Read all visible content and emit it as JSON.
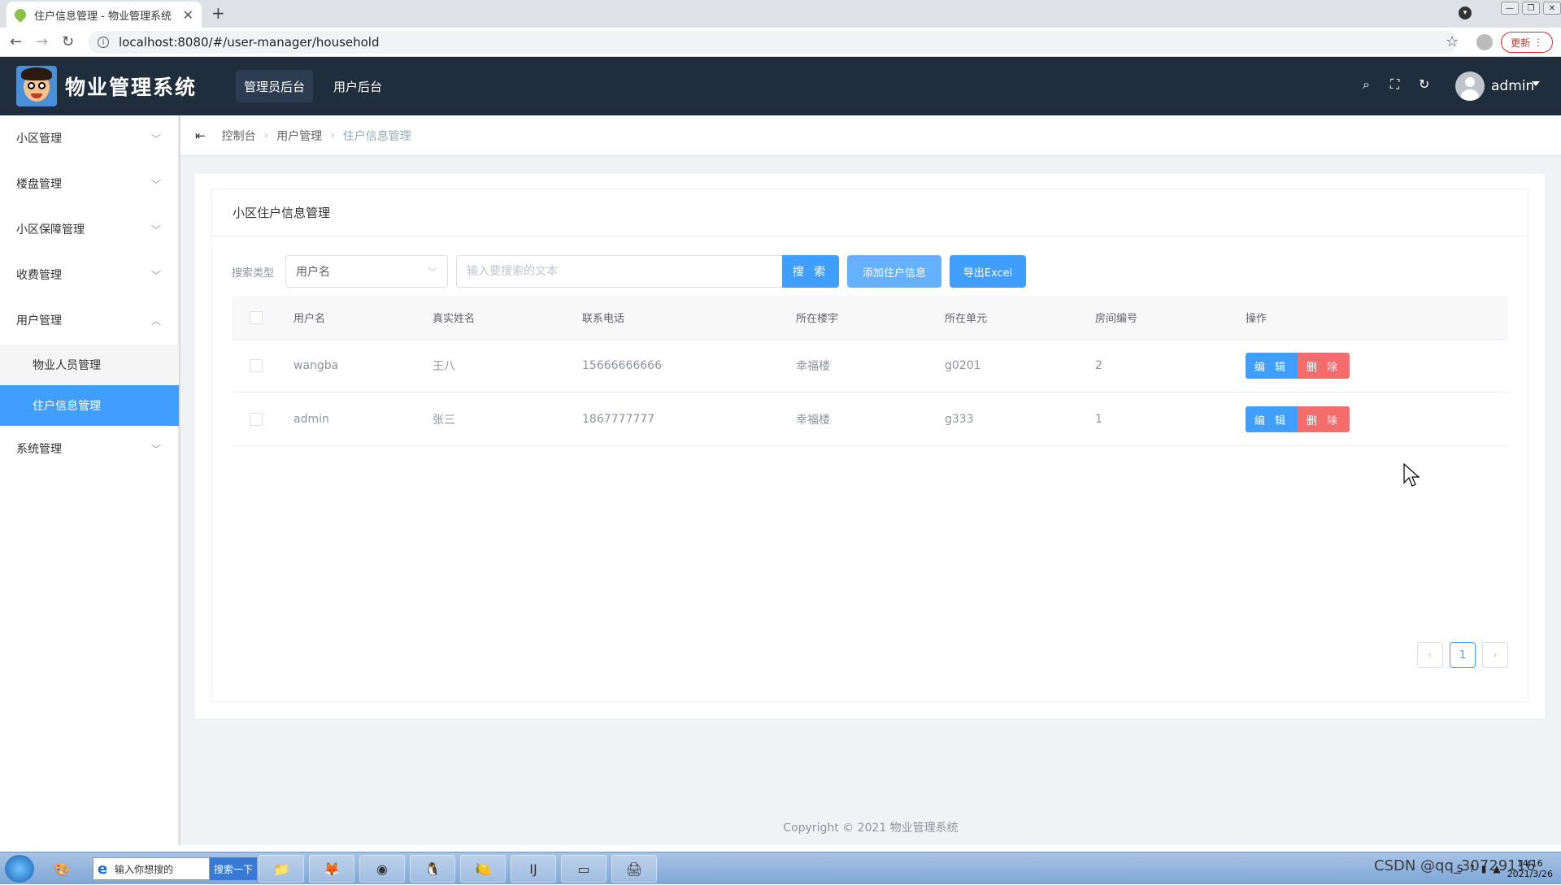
{
  "browser": {
    "tab_title": "住户信息管理 - 物业管理系统",
    "url": "localhost:8080/#/user-manager/household",
    "update_label": "更新"
  },
  "app": {
    "title": "物业管理系统",
    "nav": [
      "管理员后台",
      "用户后台"
    ],
    "user": "admin"
  },
  "sidebar": {
    "items": [
      {
        "label": "小区管理"
      },
      {
        "label": "楼盘管理"
      },
      {
        "label": "小区保障管理"
      },
      {
        "label": "收费管理"
      },
      {
        "label": "用户管理"
      },
      {
        "label": "系统管理"
      }
    ],
    "sub_items": [
      {
        "label": "物业人员管理"
      },
      {
        "label": "住户信息管理"
      }
    ]
  },
  "breadcrumb": [
    "控制台",
    "用户管理",
    "住户信息管理"
  ],
  "card": {
    "title": "小区住户信息管理",
    "search_label": "搜索类型",
    "search_type": "用户名",
    "search_placeholder": "输入要搜索的文本",
    "search_button": "搜 索",
    "add_button": "添加住户信息",
    "export_button": "导出Excel"
  },
  "table": {
    "columns": [
      "用户名",
      "真实姓名",
      "联系电话",
      "所在楼宇",
      "所在单元",
      "房间编号",
      "操作"
    ],
    "rows": [
      {
        "username": "wangba",
        "realname": "王八",
        "phone": "15666666666",
        "building": "幸福楼",
        "unit": "g0201",
        "room": "2"
      },
      {
        "username": "admin",
        "realname": "张三",
        "phone": "1867777777",
        "building": "幸福楼",
        "unit": "g333",
        "room": "1"
      }
    ],
    "edit_label": "编 辑",
    "delete_label": "删 除"
  },
  "pagination": {
    "current": "1",
    "prev": "‹",
    "next": "›"
  },
  "footer": "Copyright © 2021 物业管理系统",
  "taskbar": {
    "search_text": "输入你想搜的",
    "search_button": "搜索一下",
    "clock_time": "14:16",
    "clock_date": "2021/3/26",
    "watermark": "CSDN @qq_30729116"
  }
}
